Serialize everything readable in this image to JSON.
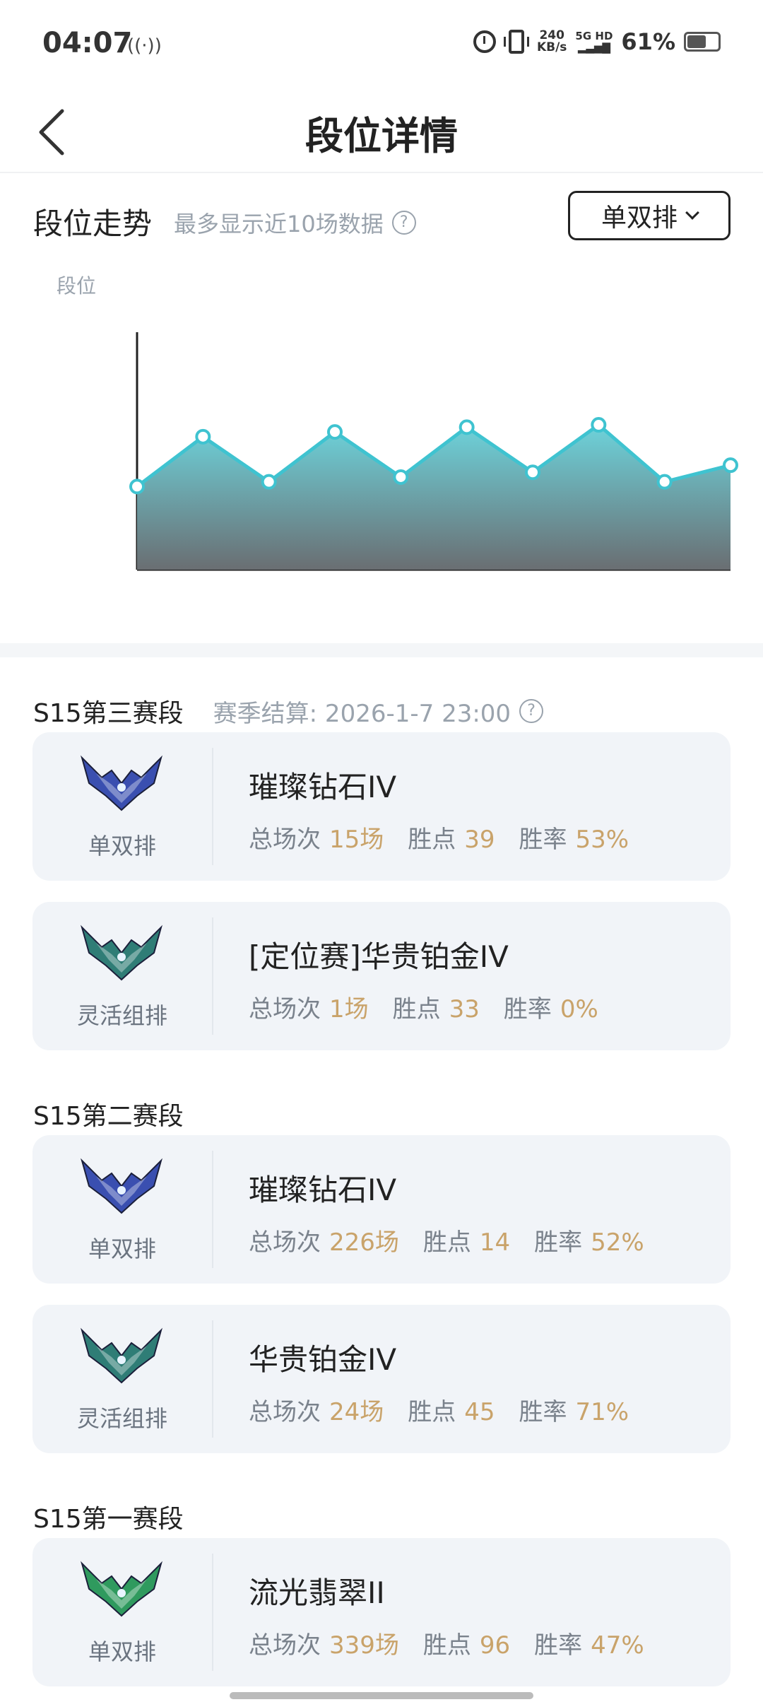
{
  "status_bar": {
    "time": "04:07",
    "net_speed_value": "240",
    "net_speed_unit": "KB/s",
    "signal_label": "5G HD",
    "battery": "61%",
    "battery_level": 0.61
  },
  "header": {
    "title": "段位详情",
    "back_icon": "chevron-left-icon"
  },
  "trend": {
    "title": "段位走势",
    "subtitle": "最多显示近10场数据",
    "help_icon": "?",
    "queue_select": "单双排",
    "y_label": "段位"
  },
  "chart_data": {
    "type": "area",
    "ylabel": "段位",
    "x": [
      1,
      2,
      3,
      4,
      5,
      6,
      7,
      8,
      9,
      10
    ],
    "values": [
      0.35,
      0.56,
      0.37,
      0.58,
      0.39,
      0.6,
      0.41,
      0.61,
      0.37,
      0.44
    ],
    "ylim": [
      0,
      1
    ],
    "grid": false,
    "colors": {
      "line": "#3fc3d0",
      "fill_top": "#6dd3db",
      "fill_bottom": "#6a6e72"
    }
  },
  "seasons": [
    {
      "title": "S15第三赛段",
      "note": "赛季结算: 2026-1-7 23:00",
      "cards": [
        {
          "queue": "单双排",
          "emblem": "diamond",
          "rank": "璀璨钻石IV",
          "games_label": "总场次",
          "games": "15场",
          "points_label": "胜点",
          "points": "39",
          "winrate_label": "胜率",
          "winrate": "53%"
        },
        {
          "queue": "灵活组排",
          "emblem": "platinum",
          "rank": "[定位赛]华贵铂金IV",
          "games_label": "总场次",
          "games": "1场",
          "points_label": "胜点",
          "points": "33",
          "winrate_label": "胜率",
          "winrate": "0%"
        }
      ]
    },
    {
      "title": "S15第二赛段",
      "note": "",
      "cards": [
        {
          "queue": "单双排",
          "emblem": "diamond",
          "rank": "璀璨钻石IV",
          "games_label": "总场次",
          "games": "226场",
          "points_label": "胜点",
          "points": "14",
          "winrate_label": "胜率",
          "winrate": "52%"
        },
        {
          "queue": "灵活组排",
          "emblem": "platinum",
          "rank": "华贵铂金IV",
          "games_label": "总场次",
          "games": "24场",
          "points_label": "胜点",
          "points": "45",
          "winrate_label": "胜率",
          "winrate": "71%"
        }
      ]
    },
    {
      "title": "S15第一赛段",
      "note": "",
      "cards": [
        {
          "queue": "单双排",
          "emblem": "emerald",
          "rank": "流光翡翠II",
          "games_label": "总场次",
          "games": "339场",
          "points_label": "胜点",
          "points": "96",
          "winrate_label": "胜率",
          "winrate": "47%"
        }
      ]
    }
  ],
  "emblem_colors": {
    "diamond": "#3a4fb0",
    "platinum": "#2f7d76",
    "emerald": "#2f9a5e"
  }
}
